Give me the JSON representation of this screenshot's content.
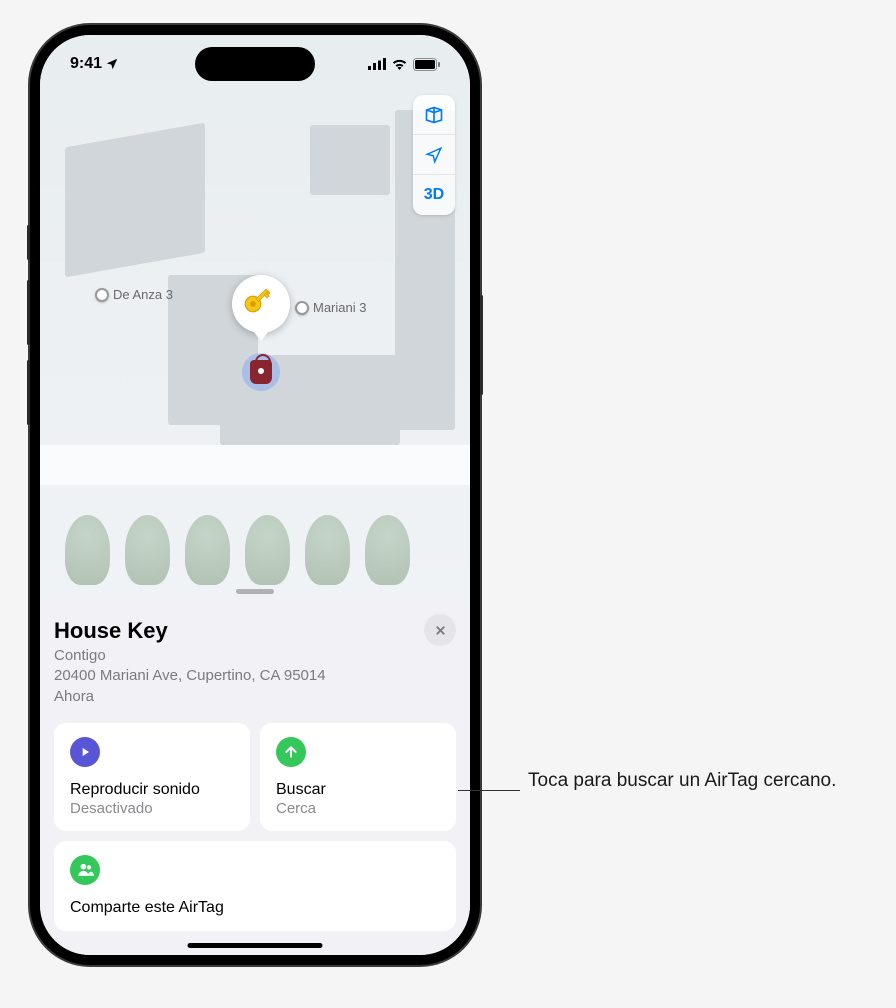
{
  "status": {
    "time": "9:41",
    "location_arrow": "➤"
  },
  "map": {
    "labels": {
      "deanza": "De Anza 3",
      "mariani": "Mariani 3"
    },
    "controls": {
      "threeD": "3D"
    }
  },
  "sheet": {
    "title": "House Key",
    "status": "Contigo",
    "address": "20400 Mariani Ave, Cupertino, CA  95014",
    "time": "Ahora"
  },
  "actions": {
    "play": {
      "title": "Reproducir sonido",
      "sub": "Desactivado"
    },
    "find": {
      "title": "Buscar",
      "sub": "Cerca"
    },
    "share": {
      "title": "Comparte este AirTag"
    }
  },
  "callout": "Toca para buscar un AirTag cercano."
}
